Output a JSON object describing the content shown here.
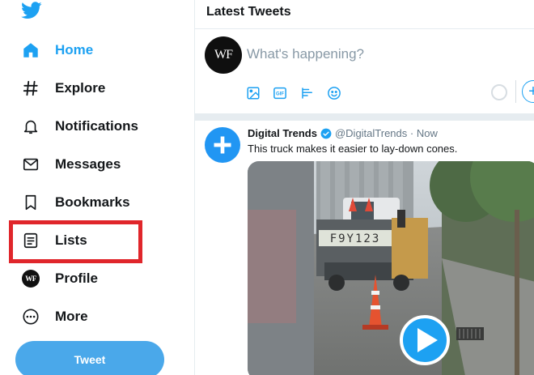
{
  "sidebar": {
    "items": [
      {
        "label": "Home",
        "icon": "home-icon"
      },
      {
        "label": "Explore",
        "icon": "hashtag-icon"
      },
      {
        "label": "Notifications",
        "icon": "bell-icon"
      },
      {
        "label": "Messages",
        "icon": "envelope-icon"
      },
      {
        "label": "Bookmarks",
        "icon": "bookmark-icon"
      },
      {
        "label": "Lists",
        "icon": "list-icon"
      },
      {
        "label": "Profile",
        "icon": "avatar"
      },
      {
        "label": "More",
        "icon": "more-icon"
      }
    ],
    "active_item": "Home",
    "profile_initials": "WF",
    "tweet_button": "Tweet"
  },
  "header": {
    "title": "Latest Tweets"
  },
  "composer": {
    "avatar_initials": "WF",
    "placeholder": "What's happening?",
    "tools": [
      "image-icon",
      "gif-icon",
      "poll-icon",
      "emoji-icon"
    ]
  },
  "tweet": {
    "author": "Digital Trends",
    "handle": "@DigitalTrends · Now",
    "text": "This truck makes it easier to lay-down cones.",
    "verified": true,
    "media": {
      "plate": "F9Y123",
      "type": "video"
    }
  },
  "colors": {
    "accent": "#1da1f2",
    "highlight_box": "#e0262b",
    "tweet_button": "#4aa8ea",
    "text": "#14171a",
    "muted": "#657786"
  }
}
